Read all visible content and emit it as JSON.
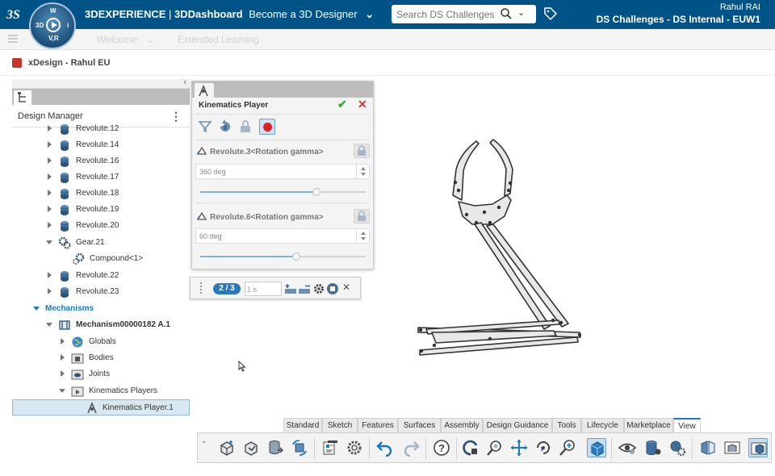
{
  "header": {
    "brand_bold": "3DEXPERIENCE",
    "separator": " | ",
    "app_name": "3DDashboard",
    "dashboard_name": "Become a 3D Designer",
    "search_placeholder": "Search DS Challenges - I",
    "user_name": "Rahul RAI",
    "tenant": "DS Challenges - DS Internal - EUW1",
    "compass": {
      "top": "W",
      "left": "3D",
      "right": "i",
      "bottom": "V,R"
    },
    "colors": {
      "bar": "#005386"
    }
  },
  "tabs": [
    {
      "label": "Welcome"
    },
    {
      "label": "Extended Learning"
    }
  ],
  "document": {
    "title": "xDesign - Rahul EU"
  },
  "design_manager": {
    "title": "Design Manager",
    "tree": [
      {
        "label": "Revolute.12",
        "icon": "joint-icon"
      },
      {
        "label": "Revolute.14",
        "icon": "joint-icon"
      },
      {
        "label": "Revolute.16",
        "icon": "joint-icon"
      },
      {
        "label": "Revolute.17",
        "icon": "joint-icon"
      },
      {
        "label": "Revolute.18",
        "icon": "joint-icon"
      },
      {
        "label": "Revolute.19",
        "icon": "joint-icon"
      },
      {
        "label": "Revolute.20",
        "icon": "joint-icon"
      },
      {
        "label": "Gear.21",
        "icon": "gear-icon"
      },
      {
        "label": "Compound<1>",
        "icon": "compound-icon"
      },
      {
        "label": "Revolute.22",
        "icon": "joint-icon"
      },
      {
        "label": "Revolute.23",
        "icon": "joint-icon"
      },
      {
        "label": "Mechanisms",
        "icon": ""
      },
      {
        "label": "Mechanism00000182 A.1",
        "icon": "mechanism-icon"
      },
      {
        "label": "Globals",
        "icon": "globe-icon"
      },
      {
        "label": "Bodies",
        "icon": "folder-icon"
      },
      {
        "label": "Joints",
        "icon": "folder-icon"
      },
      {
        "label": "Kinematics Players",
        "icon": "folder-icon"
      },
      {
        "label": "Kinematics Player.1",
        "icon": "player-icon"
      }
    ]
  },
  "kinematics_player": {
    "title": "Kinematics Player",
    "params": [
      {
        "label": "Revolute.3<Rotation gamma>",
        "value": "360 deg",
        "level": 0.7
      },
      {
        "label": "Revolute.6<Rotation gamma>",
        "value": "60 deg",
        "level": 0.58
      }
    ]
  },
  "playbar": {
    "step": "2 / 3",
    "duration": "1 s"
  },
  "action_bar": {
    "tabs": [
      "Standard",
      "Sketch",
      "Features",
      "Surfaces",
      "Assembly",
      "Design Guidance",
      "Tools",
      "Lifecycle",
      "Marketplace",
      "View"
    ],
    "active_tab": "View"
  }
}
